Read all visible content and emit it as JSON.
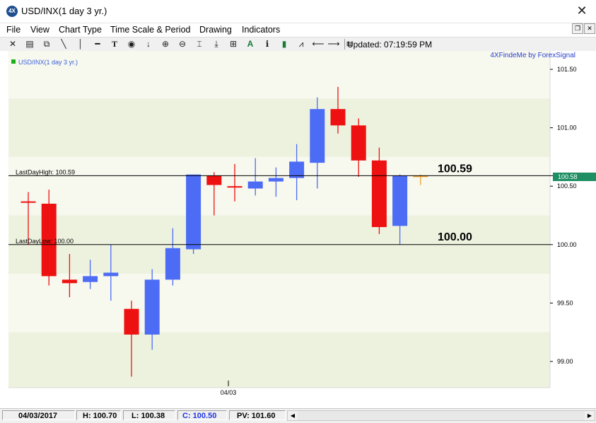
{
  "window": {
    "title": "USD/INX(1 day  3 yr.)",
    "icon": "4x-logo-icon",
    "close_glyph": "✕"
  },
  "menu": {
    "items": [
      "File",
      "View",
      "Chart Type",
      "Time Scale & Period",
      "Drawing",
      "Indicators"
    ]
  },
  "mdi": {
    "restore": "❐",
    "close": "✕"
  },
  "toolbar": {
    "updated_label": "Updated: 07:19:59 PM"
  },
  "chart": {
    "symbol_label": "USD/INX(1 day  3 yr.)",
    "brand": "4XFindeMe by ForexSignal",
    "date_label": "04/03",
    "last_price_badge": "100.58",
    "lines": {
      "high": {
        "label": "LastDayHigh: 100.59",
        "value": 100.59,
        "big_label": "100.59"
      },
      "low": {
        "label": "LastDayLow: 100.00",
        "value": 100.0,
        "big_label": "100.00"
      }
    }
  },
  "chart_data": {
    "type": "candlestick",
    "title": "USD/INX(1 day  3 yr.)",
    "ylim": [
      98.8,
      101.6
    ],
    "y_ticks": [
      "101.50",
      "101.00",
      "100.50",
      "100.00",
      "99.50",
      "99.00"
    ],
    "x_labels": [
      "04/03"
    ],
    "candles": [
      {
        "o": 100.37,
        "h": 100.45,
        "l": 100.0,
        "c": 100.36
      },
      {
        "o": 100.35,
        "h": 100.47,
        "l": 99.65,
        "c": 99.73
      },
      {
        "o": 99.7,
        "h": 99.92,
        "l": 99.55,
        "c": 99.67
      },
      {
        "o": 99.68,
        "h": 99.87,
        "l": 99.62,
        "c": 99.73
      },
      {
        "o": 99.73,
        "h": 100.0,
        "l": 99.52,
        "c": 99.76
      },
      {
        "o": 99.45,
        "h": 99.52,
        "l": 98.87,
        "c": 99.23
      },
      {
        "o": 99.23,
        "h": 99.79,
        "l": 99.1,
        "c": 99.7
      },
      {
        "o": 99.7,
        "h": 100.14,
        "l": 99.65,
        "c": 99.97
      },
      {
        "o": 99.96,
        "h": 100.6,
        "l": 99.92,
        "c": 100.6
      },
      {
        "o": 100.59,
        "h": 100.62,
        "l": 100.25,
        "c": 100.51
      },
      {
        "o": 100.5,
        "h": 100.69,
        "l": 100.37,
        "c": 100.5
      },
      {
        "o": 100.48,
        "h": 100.74,
        "l": 100.42,
        "c": 100.54
      },
      {
        "o": 100.54,
        "h": 100.66,
        "l": 100.41,
        "c": 100.57
      },
      {
        "o": 100.57,
        "h": 100.86,
        "l": 100.38,
        "c": 100.71
      },
      {
        "o": 100.7,
        "h": 101.26,
        "l": 100.48,
        "c": 101.16
      },
      {
        "o": 101.16,
        "h": 101.35,
        "l": 100.95,
        "c": 101.02
      },
      {
        "o": 101.02,
        "h": 101.08,
        "l": 100.58,
        "c": 100.72
      },
      {
        "o": 100.72,
        "h": 100.83,
        "l": 100.09,
        "c": 100.15
      },
      {
        "o": 100.16,
        "h": 100.6,
        "l": 100.0,
        "c": 100.59
      },
      {
        "o": 100.59,
        "h": 100.6,
        "l": 100.51,
        "c": 100.58
      }
    ],
    "colors": {
      "up": "#4d6cf5",
      "down": "#ee1111",
      "doji": "#f2a12f",
      "band_a": "#edf2df",
      "band_b": "#f7f8ee",
      "badge": "#1e8f63"
    }
  },
  "status": {
    "date": "04/03/2017",
    "high": "H: 100.70",
    "low": "L: 100.38",
    "close": "C: 100.50",
    "pv": "PV: 101.60"
  }
}
